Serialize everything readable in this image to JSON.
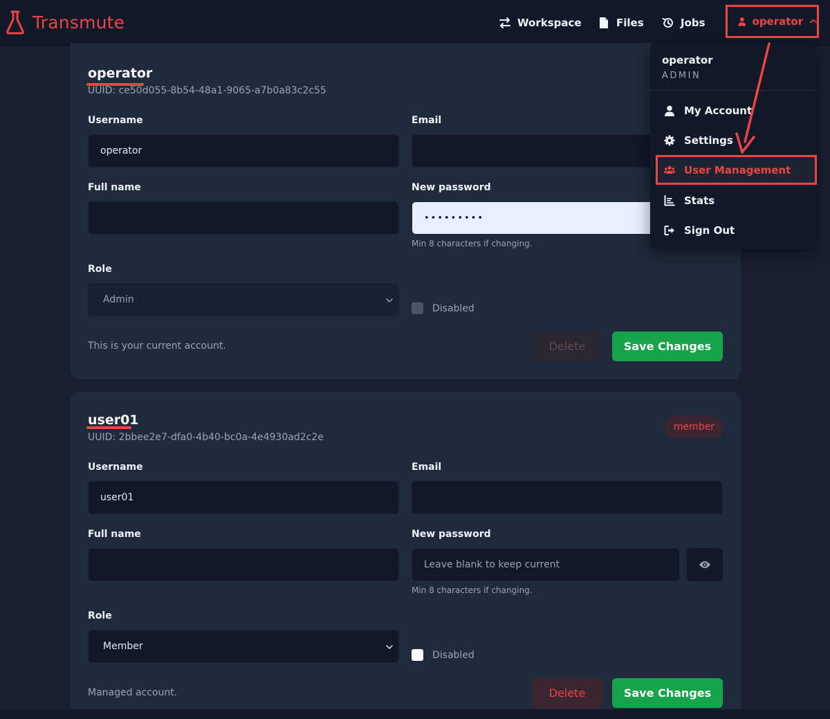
{
  "header": {
    "brand": "Transmute",
    "nav": {
      "workspace": "Workspace",
      "files": "Files",
      "jobs": "Jobs"
    },
    "user_button": "operator"
  },
  "dropdown": {
    "username": "operator",
    "role": "ADMIN",
    "items": {
      "my_account": "My Account",
      "settings": "Settings",
      "user_management": "User Management",
      "stats": "Stats",
      "sign_out": "Sign Out"
    }
  },
  "users": [
    {
      "name": "operator",
      "uuid": "UUID: ce50d055-8b54-48a1-9065-a7b0a83c2c55",
      "labels": {
        "username": "Username",
        "email": "Email",
        "full_name": "Full name",
        "new_password": "New password",
        "role": "Role"
      },
      "username": "operator",
      "email": "",
      "full_name": "",
      "password": "•••••••••",
      "password_hint": "Min 8 characters if changing.",
      "role": "Admin",
      "disabled_label": "Disabled",
      "note": "This is your current account.",
      "delete_label": "Delete",
      "save_label": "Save Changes"
    },
    {
      "name": "user01",
      "uuid": "UUID: 2bbee2e7-dfa0-4b40-bc0a-4e4930ad2c2e",
      "badge": "member",
      "labels": {
        "username": "Username",
        "email": "Email",
        "full_name": "Full name",
        "new_password": "New password",
        "role": "Role"
      },
      "username": "user01",
      "email": "",
      "full_name": "",
      "password_placeholder": "Leave blank to keep current",
      "password_hint": "Min 8 characters if changing.",
      "role": "Member",
      "disabled_label": "Disabled",
      "note": "Managed account.",
      "delete_label": "Delete",
      "save_label": "Save Changes"
    }
  ],
  "colors": {
    "accent": "#ef4444",
    "save": "#16a34a",
    "background": "#182032",
    "card": "#1f2a3c"
  }
}
